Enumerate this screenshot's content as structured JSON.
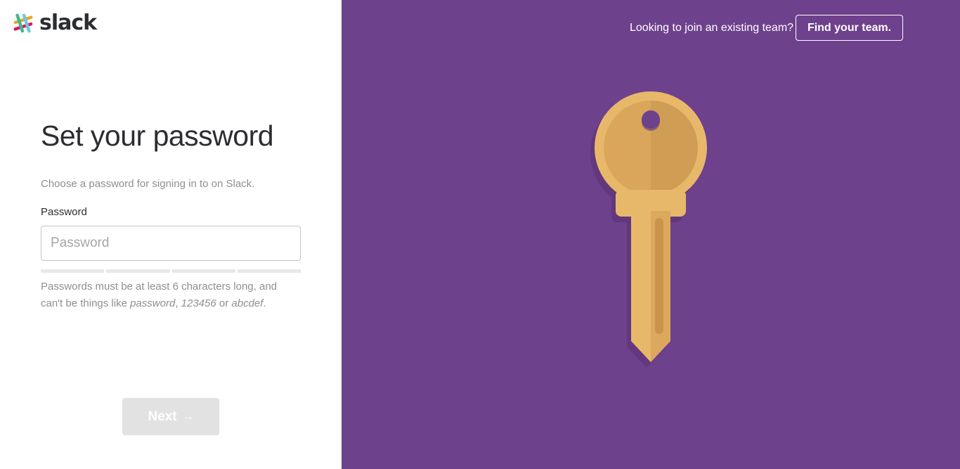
{
  "brand": {
    "name": "slack",
    "colors": {
      "purple": "#6e418c",
      "key_gold": "#e8b86a",
      "teal": "#3eb991",
      "blue": "#6ecadc",
      "yellow": "#e9a820",
      "pink": "#e01563"
    }
  },
  "header": {
    "join_prompt": "Looking to join an existing team?",
    "find_team_label": "Find your team."
  },
  "form": {
    "title": "Set your password",
    "subtitle": "Choose a password for signing in to on Slack.",
    "password_label": "Password",
    "password_placeholder": "Password",
    "password_value": "",
    "strength_level": 0,
    "hint_prefix": "Passwords must be at least 6 characters long, and can't be things like",
    "hint_example_1": "password",
    "hint_separator": ",",
    "hint_example_2": "123456",
    "hint_or": "or",
    "hint_example_3": "abcdef",
    "hint_end": ".",
    "next_label": "Next",
    "next_icon": "arrow-right-icon"
  },
  "illustration": {
    "icon": "key-icon"
  }
}
